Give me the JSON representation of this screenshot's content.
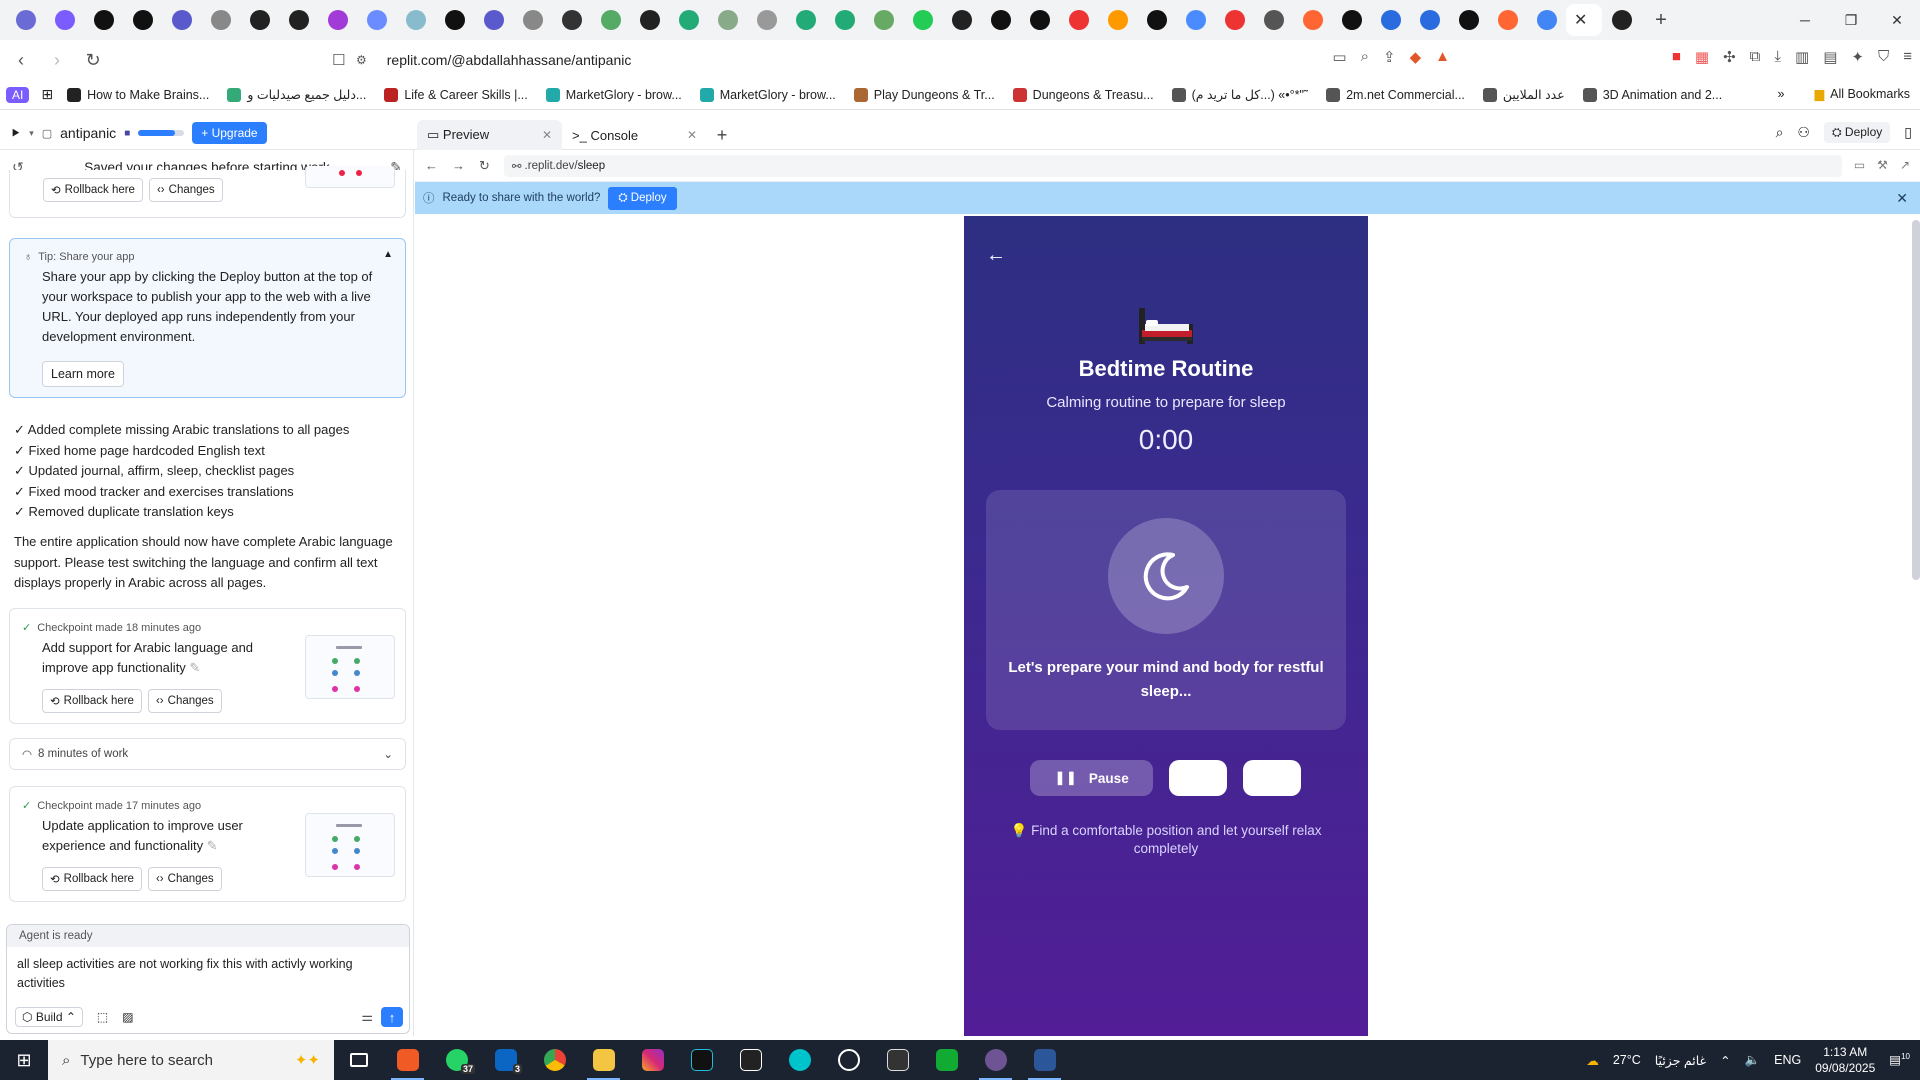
{
  "browser": {
    "tab_count_icons": 42,
    "active_tab_close": "✕",
    "url": "replit.com/@abdallahhassane/antipanic",
    "bookmarks": [
      {
        "label": "How to Make Brains...",
        "color": "#222"
      },
      {
        "label": "دليل جميع صيدليات و...",
        "color": "#3a7"
      },
      {
        "label": "Life & Career Skills |...",
        "color": "#b22"
      },
      {
        "label": "MarketGlory - brow...",
        "color": "#2aa"
      },
      {
        "label": "MarketGlory - brow...",
        "color": "#2aa"
      },
      {
        "label": "Play Dungeons & Tr...",
        "color": "#a63"
      },
      {
        "label": "Dungeons & Treasu...",
        "color": "#c33"
      },
      {
        "label": "(كل ما تريد م...) «•°*\"˜",
        "color": "#555"
      },
      {
        "label": "2m.net Commercial...",
        "color": "#555"
      },
      {
        "label": "عدد الملايين",
        "color": "#555"
      },
      {
        "label": "3D Animation and 2...",
        "color": "#555"
      }
    ],
    "bookmarks_ai": "AI",
    "all_bookmarks": "All Bookmarks"
  },
  "workspace": {
    "project_name": "antipanic",
    "progress_fraction": 0.8,
    "upgrade_label": "Upgrade",
    "tabs": [
      {
        "label": "Preview",
        "icon": "window-icon"
      },
      {
        "label": "Console",
        "icon": "terminal-icon"
      }
    ],
    "deploy_label": "Deploy"
  },
  "chat": {
    "saved_text": "Saved your changes before starting work",
    "rollback_label": "Rollback here",
    "changes_label": "Changes",
    "tip_title": "Tip: Share your app",
    "tip_body": "Share your app by clicking the Deploy button at the top of your workspace to publish your app to the web with a live URL. Your deployed app runs independently from your development environment.",
    "learn_more": "Learn more",
    "checklist": [
      "✓ Added complete missing Arabic translations to all pages",
      "✓ Fixed home page hardcoded English text",
      "✓ Updated journal, affirm, sleep, checklist pages",
      "✓ Fixed mood tracker and exercises translations",
      "✓ Removed duplicate translation keys"
    ],
    "summary": "The entire application should now have complete Arabic language support. Please test switching the language and confirm all text displays properly in Arabic across all pages.",
    "checkpoints": [
      {
        "meta": "Checkpoint made 18 minutes ago",
        "title": "Add support for Arabic language and improve app functionality"
      },
      {
        "meta": "Checkpoint made 17 minutes ago",
        "title": "Update application to improve user experience and functionality"
      }
    ],
    "work_label": "8 minutes of work",
    "agent_status": "Agent is ready",
    "agent_input": "all sleep activities are not working fix this with activly working activities",
    "build_label": "Build"
  },
  "preview": {
    "url_prefix": ".replit.dev/",
    "url_path": "sleep",
    "share_text": "Ready to share with the world?",
    "share_deploy": "Deploy",
    "app": {
      "title": "Bedtime Routine",
      "subtitle": "Calming routine to prepare for sleep",
      "timer": "0:00",
      "card_text": "Let's prepare your mind and body for restful sleep...",
      "pause_label": "Pause",
      "hint": "💡 Find a comfortable position and let yourself relax completely"
    }
  },
  "taskbar": {
    "search_placeholder": "Type here to search",
    "whatsapp_badge": "37",
    "linkedin_badge": "3",
    "weather": "27°C",
    "weather_text": "غائم جزئيًا",
    "lang": "ENG",
    "time": "1:13 AM",
    "date": "09/08/2025",
    "notif_count": "10"
  }
}
